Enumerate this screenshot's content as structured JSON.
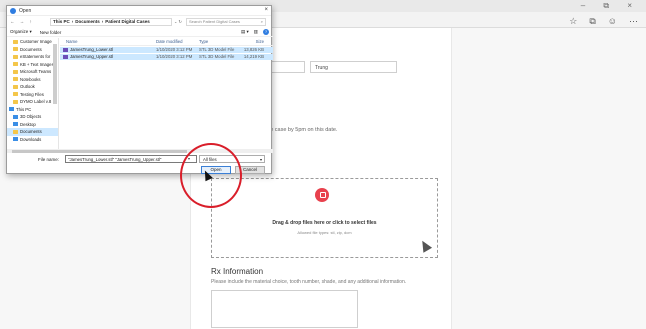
{
  "browser": {
    "window_controls": "– ⧉ ×",
    "toolbar_icons": [
      "☆",
      "⧉",
      "☺",
      "⋯"
    ]
  },
  "page": {
    "last_name_value": "Trung",
    "deadline_text": "liver the case by 5pm on this date.",
    "upload_heading": "load",
    "dropzone_title": "Drag & drop files here or click to select files",
    "dropzone_subtitle": "Allowed file types: stl, zip, dcm",
    "rx_heading": "Rx Information",
    "rx_description": "Please include the material choice, tooth number, shade, and any additional information."
  },
  "dialog": {
    "title": "Open",
    "nav_arrows": "← → ↑",
    "breadcrumb": [
      "This PC",
      "Documents",
      "Patient Digital Cases"
    ],
    "search_placeholder": "Search Patient Digital Cases",
    "toolbar": {
      "organize": "Organize ▾",
      "new_folder": "New folder"
    },
    "nav_items": [
      {
        "label": "Customer Image",
        "kind": "folder"
      },
      {
        "label": "Documents",
        "kind": "folder"
      },
      {
        "label": "eStatements for",
        "kind": "folder"
      },
      {
        "label": "KB + Text Images",
        "kind": "folder"
      },
      {
        "label": "Microsoft Teams",
        "kind": "folder"
      },
      {
        "label": "Notebooks",
        "kind": "folder"
      },
      {
        "label": "Outlook",
        "kind": "folder"
      },
      {
        "label": "Testing Files",
        "kind": "folder"
      },
      {
        "label": "DYMO Label v.8",
        "kind": "folder"
      },
      {
        "label": "This PC",
        "kind": "pc"
      },
      {
        "label": "3D Objects",
        "kind": "pc"
      },
      {
        "label": "Desktop",
        "kind": "pc"
      },
      {
        "label": "Documents",
        "kind": "folder",
        "selected": true
      },
      {
        "label": "Downloads",
        "kind": "pc"
      }
    ],
    "columns": {
      "name": "Name",
      "date": "Date modified",
      "type": "Type",
      "size": "Size"
    },
    "files": [
      {
        "name": "JamesTrung_Lower.stl",
        "date": "1/10/2020 3:12 PM",
        "type": "STL 3D Model File",
        "size": "13,826 KB"
      },
      {
        "name": "JamesTrung_Upper.stl",
        "date": "1/10/2020 3:12 PM",
        "type": "STL 3D Model File",
        "size": "14,219 KB"
      }
    ],
    "file_name_label": "File name:",
    "file_name_value": "\"JamesTrung_Lower.stl\" \"JamesTrung_Upper.stl\"",
    "filter_value": "All files",
    "open_label": "Open",
    "cancel_label": "Cancel"
  }
}
